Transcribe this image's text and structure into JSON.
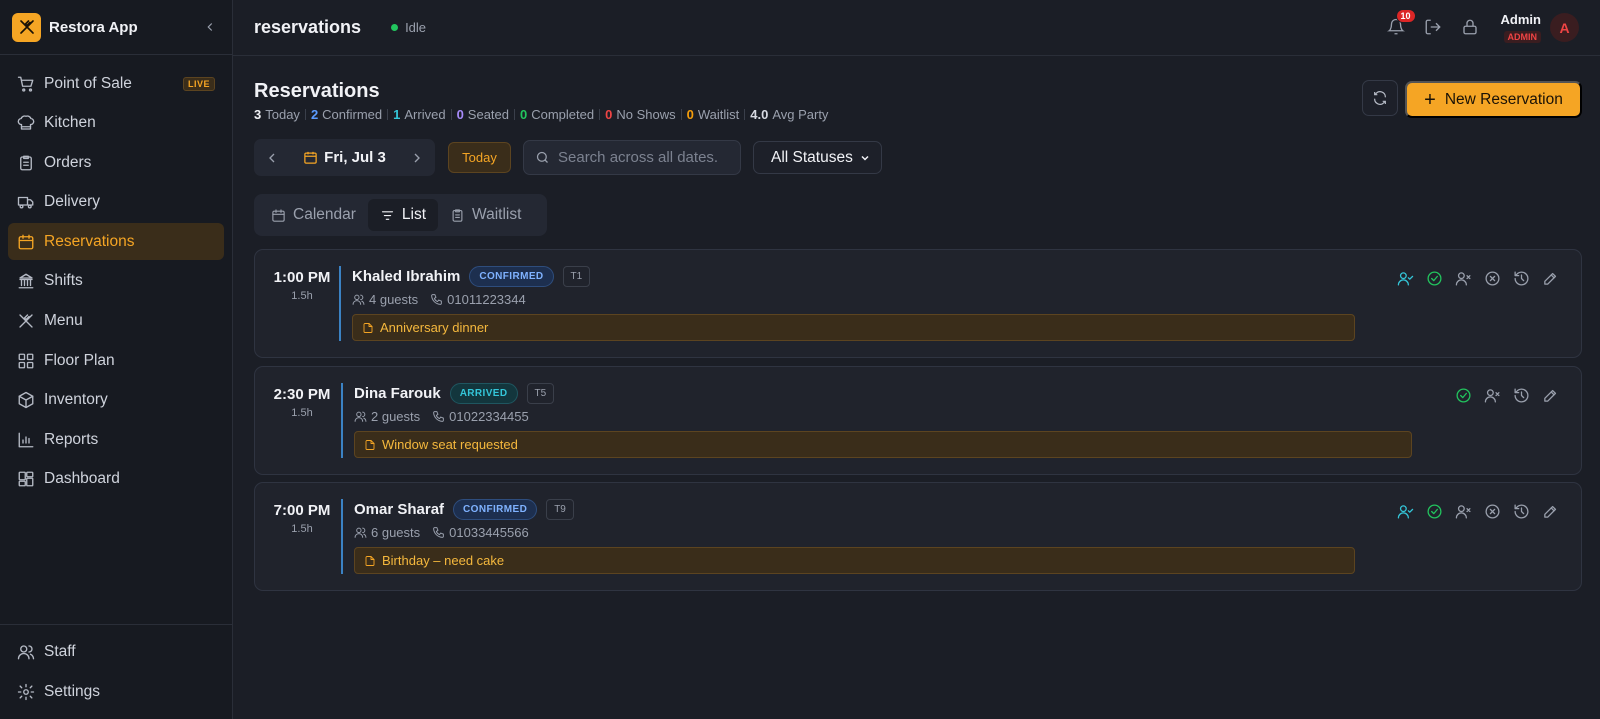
{
  "app": {
    "name": "Restora App"
  },
  "sidebar": {
    "items": [
      {
        "label": "Point of Sale",
        "badge": "LIVE",
        "icon": "cart-icon"
      },
      {
        "label": "Kitchen",
        "icon": "chef-hat-icon"
      },
      {
        "label": "Orders",
        "icon": "clipboard-icon"
      },
      {
        "label": "Delivery",
        "icon": "truck-icon"
      },
      {
        "label": "Reservations",
        "icon": "calendar-icon",
        "active": true
      },
      {
        "label": "Shifts",
        "icon": "landmark-icon"
      },
      {
        "label": "Menu",
        "icon": "utensils-icon"
      },
      {
        "label": "Floor Plan",
        "icon": "grid-icon"
      },
      {
        "label": "Inventory",
        "icon": "package-icon"
      },
      {
        "label": "Reports",
        "icon": "bar-chart-icon"
      },
      {
        "label": "Dashboard",
        "icon": "dashboard-icon"
      }
    ],
    "bottom": [
      {
        "label": "Staff",
        "icon": "users-icon"
      },
      {
        "label": "Settings",
        "icon": "gear-icon"
      }
    ]
  },
  "header": {
    "route": "reservations",
    "status": "Idle",
    "notifications": "10",
    "user_name": "Admin",
    "user_role": "ADMIN",
    "avatar_initial": "A"
  },
  "page": {
    "title": "Reservations",
    "new_button": "New Reservation",
    "stats": [
      {
        "value": "3",
        "label": "Today",
        "color": "#f1f2f6"
      },
      {
        "value": "2",
        "label": "Confirmed",
        "color": "#5b9bff"
      },
      {
        "value": "1",
        "label": "Arrived",
        "color": "#34c6d9"
      },
      {
        "value": "0",
        "label": "Seated",
        "color": "#a78bfa"
      },
      {
        "value": "0",
        "label": "Completed",
        "color": "#22c55e"
      },
      {
        "value": "0",
        "label": "No Shows",
        "color": "#ef4444"
      },
      {
        "value": "0",
        "label": "Waitlist",
        "color": "#f59e0b"
      },
      {
        "value": "4.0",
        "label": "Avg Party",
        "color": "#d7dae2"
      }
    ]
  },
  "filters": {
    "date": "Fri, Jul 3",
    "today_label": "Today",
    "search_placeholder": "Search across all dates...",
    "status_selected": "All Statuses"
  },
  "tabs": [
    {
      "label": "Calendar",
      "icon": "calendar-icon",
      "active": false
    },
    {
      "label": "List",
      "icon": "list-icon",
      "active": true
    },
    {
      "label": "Waitlist",
      "icon": "clipboard-icon",
      "active": false
    }
  ],
  "reservations": [
    {
      "time": "1:00 PM",
      "duration": "1.5h",
      "name": "Khaled Ibrahim",
      "status": "CONFIRMED",
      "table": "T1",
      "guests": "4 guests",
      "phone": "01011223344",
      "note": "Anniversary dinner",
      "actions": [
        "seat",
        "complete",
        "no-show",
        "cancel",
        "history",
        "edit"
      ]
    },
    {
      "time": "2:30 PM",
      "duration": "1.5h",
      "name": "Dina Farouk",
      "status": "ARRIVED",
      "table": "T5",
      "guests": "2 guests",
      "phone": "01022334455",
      "note": "Window seat requested",
      "actions": [
        "complete",
        "no-show",
        "history",
        "edit"
      ]
    },
    {
      "time": "7:00 PM",
      "duration": "1.5h",
      "name": "Omar Sharaf",
      "status": "CONFIRMED",
      "table": "T9",
      "guests": "6 guests",
      "phone": "01033445566",
      "note": "Birthday – need cake",
      "actions": [
        "seat",
        "complete",
        "no-show",
        "cancel",
        "history",
        "edit"
      ]
    }
  ]
}
